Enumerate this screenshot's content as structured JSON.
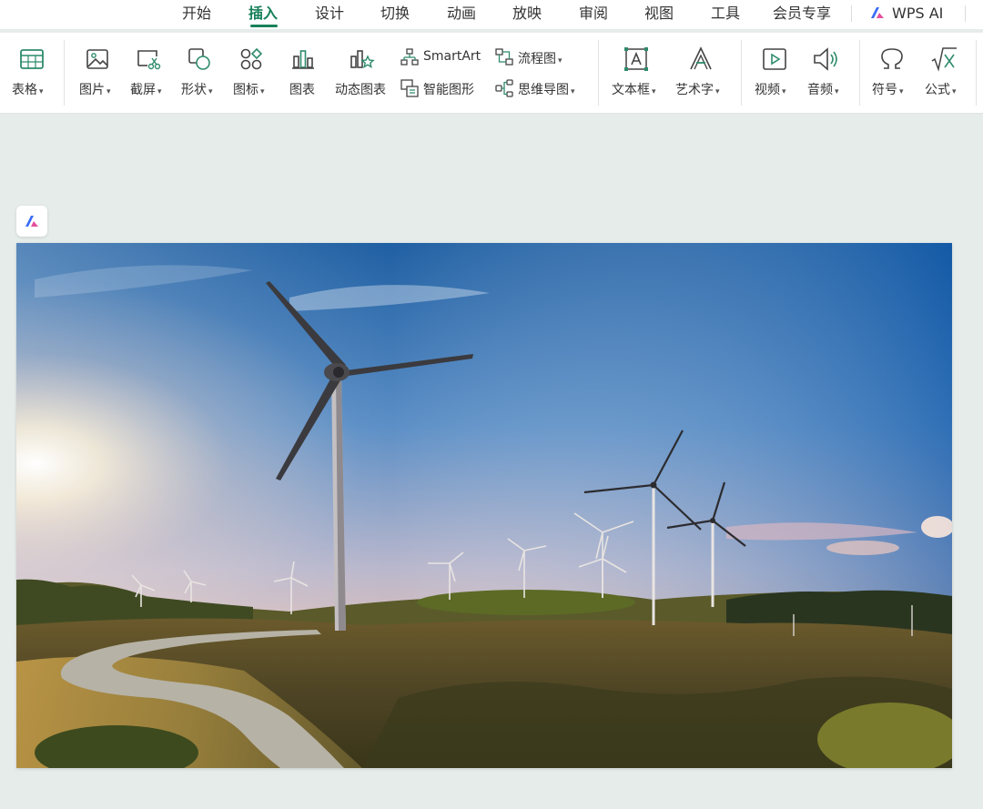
{
  "menu": {
    "tabs": [
      {
        "label": "开始"
      },
      {
        "label": "插入"
      },
      {
        "label": "设计"
      },
      {
        "label": "切换"
      },
      {
        "label": "动画"
      },
      {
        "label": "放映"
      },
      {
        "label": "审阅"
      },
      {
        "label": "视图"
      },
      {
        "label": "工具"
      },
      {
        "label": "会员专享"
      }
    ],
    "active_tab": "插入",
    "wps_ai": "WPS AI"
  },
  "ribbon": {
    "table": "表格",
    "picture": "图片",
    "screenshot": "截屏",
    "shape": "形状",
    "icon": "图标",
    "chart": "图表",
    "dynamic_chart": "动态图表",
    "smartart": "SmartArt",
    "smart_graphic": "智能图形",
    "flowchart": "流程图",
    "mindmap": "思维导图",
    "textbox": "文本框",
    "wordart": "艺术字",
    "video": "视频",
    "audio": "音频",
    "symbol": "符号",
    "formula": "公式"
  },
  "colors": {
    "accent": "#17805a",
    "workspace": "#e5ecea"
  }
}
